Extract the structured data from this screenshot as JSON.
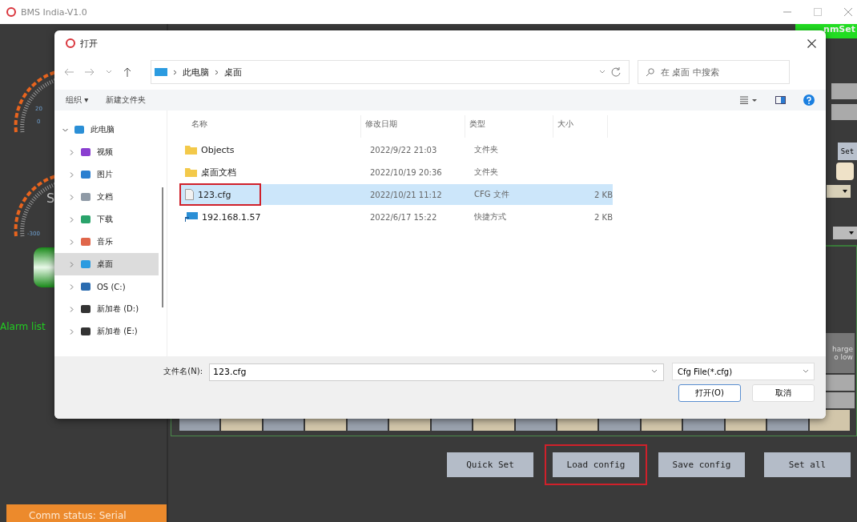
{
  "app": {
    "title": "BMS India-V1.0",
    "tab_fragment": "nmSet",
    "gauges": [
      {
        "labels": [
          "20",
          "0"
        ]
      },
      {
        "labels": [
          "-300"
        ]
      }
    ],
    "letter": "S",
    "alarm_label": "Alarm list",
    "status": "Comm status: Serial",
    "side_set": "Set",
    "side_lines": [
      "harge",
      "o low"
    ],
    "buttons": [
      {
        "label": "Quick Set",
        "highlighted": false
      },
      {
        "label": "Load config",
        "highlighted": true
      },
      {
        "label": "Save config",
        "highlighted": false
      },
      {
        "label": "Set all",
        "highlighted": false
      }
    ]
  },
  "dialog": {
    "title": "打开",
    "path": [
      "此电脑",
      "桌面"
    ],
    "search": {
      "placeholder": "在 桌面 中搜索"
    },
    "toolbar": {
      "organize": "组织 ▾",
      "new_folder": "新建文件夹"
    },
    "tree": [
      {
        "label": "此电脑",
        "expanded": true,
        "selected": false,
        "children": [
          {
            "label": "视频",
            "expanded": false,
            "selected": false
          },
          {
            "label": "图片",
            "expanded": false,
            "selected": false
          },
          {
            "label": "文档",
            "expanded": false,
            "selected": false
          },
          {
            "label": "下载",
            "expanded": false,
            "selected": false
          },
          {
            "label": "音乐",
            "expanded": false,
            "selected": false
          },
          {
            "label": "桌面",
            "expanded": false,
            "selected": true
          },
          {
            "label": "OS (C:)",
            "expanded": false,
            "selected": false
          },
          {
            "label": "新加卷 (D:)",
            "expanded": false,
            "selected": false
          },
          {
            "label": "新加卷 (E:)",
            "expanded": false,
            "selected": false
          }
        ]
      }
    ],
    "columns": [
      "名称",
      "修改日期",
      "类型",
      "大小"
    ],
    "files": [
      {
        "name": "Objects",
        "kind": "folder",
        "date": "2022/9/22 21:03",
        "type": "文件夹",
        "selected": false,
        "highlighted": false
      },
      {
        "name": "桌面文档",
        "kind": "folder",
        "date": "2022/10/19 20:36",
        "type": "文件夹",
        "selected": false,
        "highlighted": false
      },
      {
        "name": "123.cfg",
        "kind": "file",
        "date": "2022/10/21 11:12",
        "type": "CFG 文件",
        "size": "2 KB",
        "selected": true,
        "highlighted": true
      },
      {
        "name": "192.168.1.57",
        "kind": "shortcut",
        "date": "2022/6/17 15:22",
        "type": "快捷方式",
        "size": "2 KB",
        "selected": false,
        "highlighted": false
      }
    ],
    "filename_label": "文件名(N):",
    "filename": "123.cfg",
    "filter": "Cfg File(*.cfg)",
    "open_button": "打开(O)",
    "cancel_button": "取消"
  }
}
